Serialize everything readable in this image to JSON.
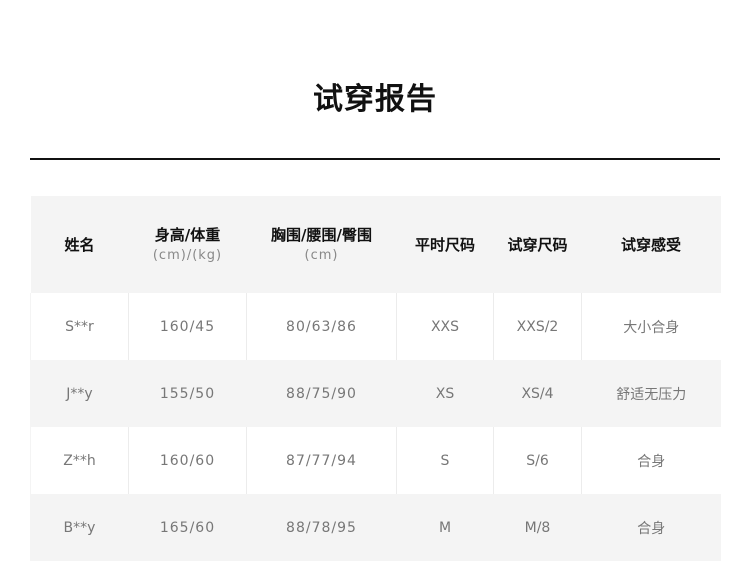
{
  "title": "试穿报告",
  "table": {
    "headers": [
      {
        "label": "姓名",
        "unit": ""
      },
      {
        "label": "身高/体重",
        "unit": "(cm)/(kg)"
      },
      {
        "label": "胸围/腰围/臀围",
        "unit": "(cm)"
      },
      {
        "label": "平时尺码",
        "unit": ""
      },
      {
        "label": "试穿尺码",
        "unit": ""
      },
      {
        "label": "试穿感受",
        "unit": ""
      }
    ],
    "rows": [
      [
        "S**r",
        "160/45",
        "80/63/86",
        "XXS",
        "XXS/2",
        "大小合身"
      ],
      [
        "J**y",
        "155/50",
        "88/75/90",
        "XS",
        "XS/4",
        "舒适无压力"
      ],
      [
        "Z**h",
        "160/60",
        "87/77/94",
        "S",
        "S/6",
        "合身"
      ],
      [
        "B**y",
        "165/60",
        "88/78/95",
        "M",
        "M/8",
        "合身"
      ]
    ]
  }
}
